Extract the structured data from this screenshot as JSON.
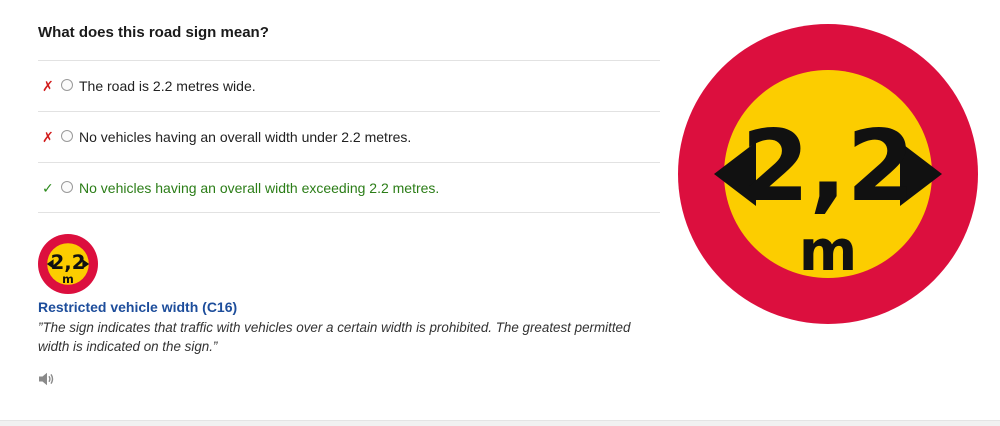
{
  "question": "What does this road sign mean?",
  "options": [
    {
      "label": "The road is 2.2 metres wide.",
      "mark": "✗",
      "status": "wrong"
    },
    {
      "label": "No vehicles having an overall width under 2.2 metres.",
      "mark": "✗",
      "status": "wrong"
    },
    {
      "label": "No vehicles having an overall width exceeding 2.2 metres.",
      "mark": "✓",
      "status": "correct"
    }
  ],
  "sign": {
    "value_text": "2,2",
    "unit_text": "m",
    "name": "Restricted vehicle width (C16)",
    "description": "”The sign indicates that traffic with vehicles over a certain width is prohibited. The greatest permitted width is indicated on the sign.”"
  },
  "icons": {
    "wrong": "cross-mark-icon",
    "correct": "check-mark-icon",
    "audio": "speaker-icon"
  },
  "colors": {
    "sign_red": "#dc0f3e",
    "sign_yellow": "#fccd00",
    "sign_black": "#111111",
    "correct_text": "#2b7d17",
    "wrong_mark": "#d21c1c",
    "sign_name": "#1d4d9b"
  }
}
